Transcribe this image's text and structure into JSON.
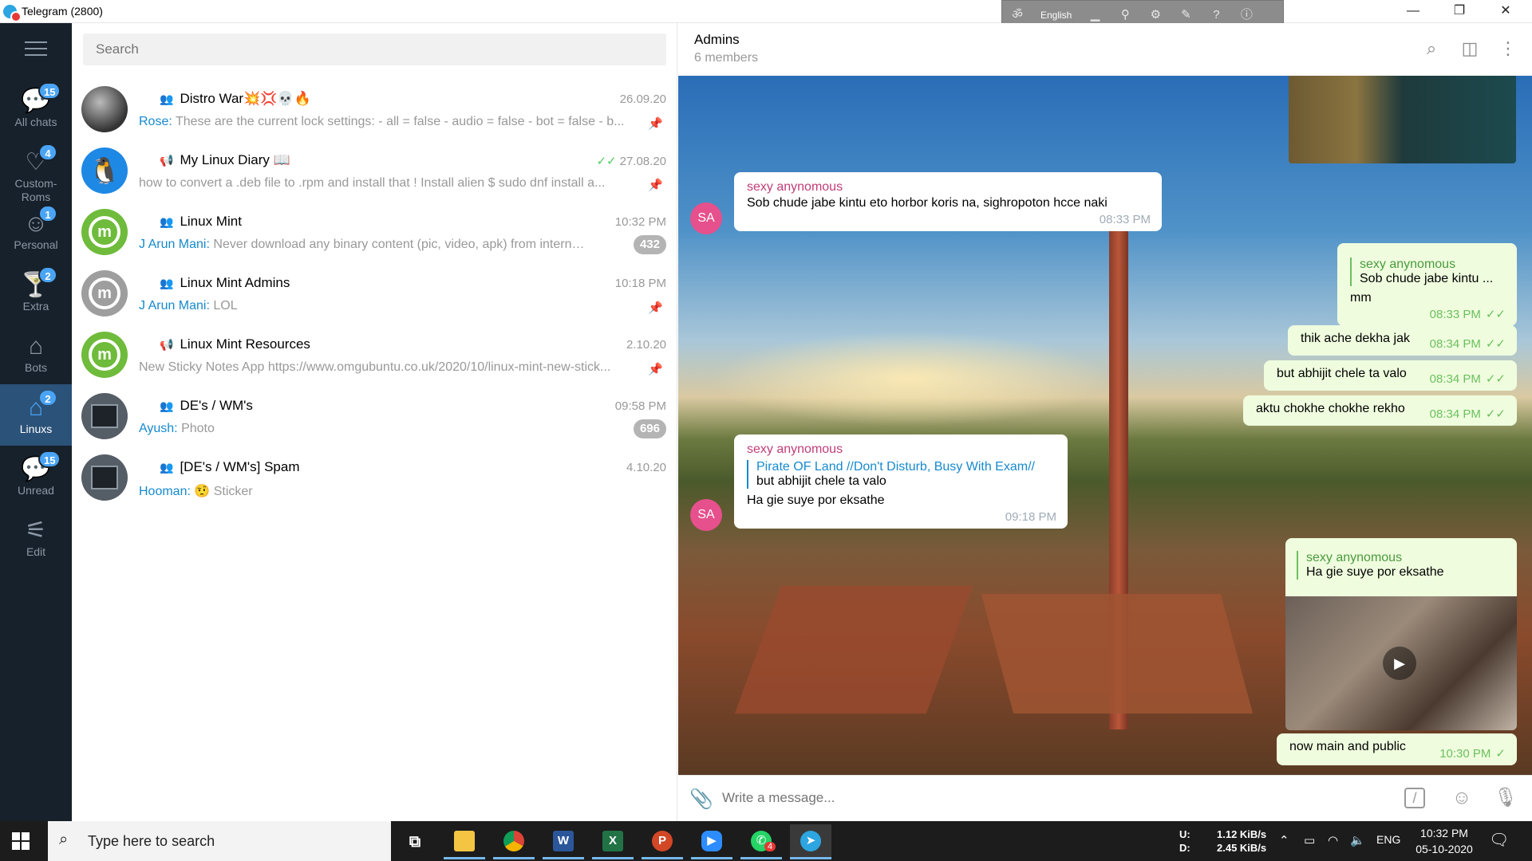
{
  "window": {
    "title": "Telegram (2800)",
    "min": "—",
    "max": "❐",
    "close": "✕"
  },
  "ime": {
    "lang": "English"
  },
  "folders": [
    {
      "label": "All chats",
      "badge": "15",
      "icon": "chat-bubble-icon"
    },
    {
      "label": "Custom-\nRoms",
      "badge": "4",
      "icon": "heart-icon"
    },
    {
      "label": "Personal",
      "badge": "1",
      "icon": "person-icon"
    },
    {
      "label": "Extra",
      "badge": "2",
      "icon": "cocktail-icon"
    },
    {
      "label": "Bots",
      "badge": "",
      "icon": "robot-icon"
    },
    {
      "label": "Linuxs",
      "badge": "2",
      "icon": "house-icon"
    },
    {
      "label": "Unread",
      "badge": "15",
      "icon": "chat-bubble-icon"
    },
    {
      "label": "Edit",
      "badge": "",
      "icon": "sliders-icon"
    }
  ],
  "search": {
    "placeholder": "Search"
  },
  "chats": [
    {
      "name": "Distro War💥💢💀🔥",
      "time": "26.09.20",
      "who": "Rose:",
      "preview": " These are the current lock settings: - all = false - audio = false - bot = false - b...",
      "pinned": true,
      "unread": "",
      "type": "group"
    },
    {
      "name": "My Linux Diary 📖",
      "time": "27.08.20",
      "who": "",
      "preview": "how to convert a .deb file to .rpm and install that ! Install alien $ sudo dnf install a...",
      "pinned": true,
      "unread": "",
      "type": "channel",
      "ticks": "✓✓"
    },
    {
      "name": "Linux Mint",
      "time": "10:32 PM",
      "who": "J Arun Mani:",
      "preview": " Never download any binary content (pic, video, apk) from internet if...",
      "pinned": false,
      "unread": "432",
      "type": "group"
    },
    {
      "name": "Linux Mint Admins",
      "time": "10:18 PM",
      "who": "J Arun Mani:",
      "preview": " LOL",
      "pinned": true,
      "unread": "",
      "type": "group"
    },
    {
      "name": "Linux Mint Resources",
      "time": "2.10.20",
      "who": "",
      "preview": "New Sticky Notes App https://www.omgubuntu.co.uk/2020/10/linux-mint-new-stick...",
      "pinned": true,
      "unread": "",
      "type": "channel"
    },
    {
      "name": "DE's / WM's",
      "time": "09:58 PM",
      "who": "Ayush:",
      "preview": " Photo",
      "pinned": false,
      "unread": "696",
      "type": "group"
    },
    {
      "name": "[DE's / WM's] Spam",
      "time": "4.10.20",
      "who": "Hooman:",
      "preview": " 🤨 Sticker",
      "pinned": false,
      "unread": "",
      "type": "group"
    }
  ],
  "chat": {
    "title": "Admins",
    "subtitle": "6 members"
  },
  "messages": {
    "m1": {
      "sender": "sexy anynomous",
      "text": "Sob chude jabe kintu eto horbor koris na, sighropoton hcce naki",
      "time": "08:33 PM",
      "avatar": "SA"
    },
    "m2": {
      "reply_name": "sexy anynomous",
      "reply_text": "Sob chude jabe kintu ...",
      "text": "mm",
      "time": "08:33 PM"
    },
    "m3": {
      "text": "thik ache dekha jak",
      "time": "08:34 PM"
    },
    "m4": {
      "text": "but abhijit chele ta valo",
      "time": "08:34 PM"
    },
    "m5": {
      "text": "aktu chokhe chokhe rekho",
      "time": "08:34 PM"
    },
    "m6": {
      "sender": "sexy anynomous",
      "reply_name": "Pirate OF Land //Don't Disturb, Busy With Exam//",
      "reply_text": "but abhijit chele ta valo",
      "text": "Ha gie suye por eksathe",
      "time": "09:18 PM",
      "avatar": "SA"
    },
    "m7": {
      "reply_name": "sexy anynomous",
      "reply_text": "Ha gie suye por eksathe"
    },
    "m8": {
      "text": "now main and public",
      "time": "10:30 PM"
    }
  },
  "composer": {
    "placeholder": "Write a message..."
  },
  "taskbar": {
    "search_text": "Type here to search",
    "whatsapp_badge": "4",
    "net_up_label": "U:",
    "net_down_label": "D:",
    "net_up": "1.12 KiB/s",
    "net_down": "2.45 KiB/s",
    "lang": "ENG",
    "time": "10:32 PM",
    "date": "05-10-2020"
  },
  "colors": {
    "sidebar": "#17212b",
    "active_folder": "#2b5278",
    "badge": "#4aa4f5",
    "sender": "#c03d78",
    "out_bubble": "#effdde"
  }
}
